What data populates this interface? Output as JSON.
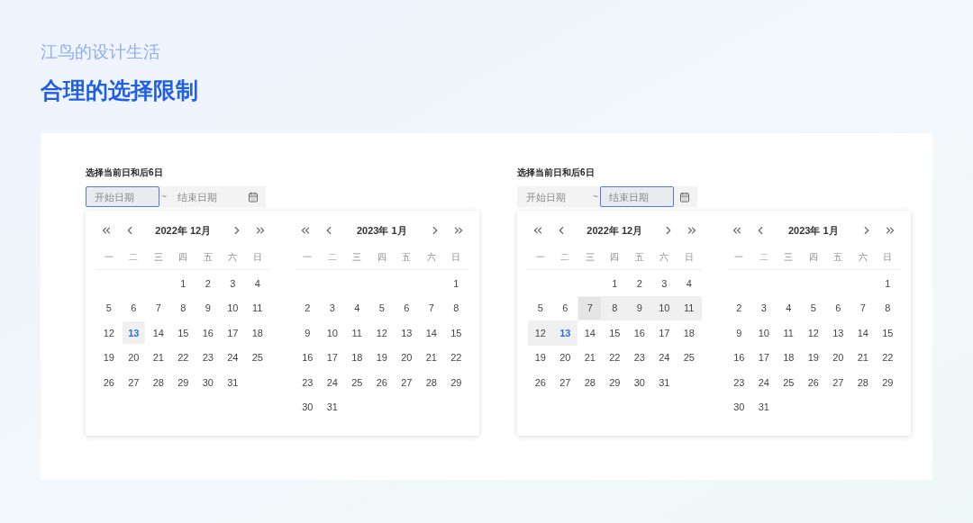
{
  "header": {
    "subtitle": "江鸟的设计生活",
    "title": "合理的选择限制"
  },
  "demos": [
    {
      "label": "选择当前日和后6日",
      "start_field": {
        "placeholder": "开始日期",
        "focused": true
      },
      "separator": "~",
      "end_field": {
        "placeholder": "结束日期",
        "focused": false
      },
      "months": [
        {
          "title": "2022年 12月",
          "weekdays": [
            "一",
            "二",
            "三",
            "四",
            "五",
            "六",
            "日"
          ],
          "days": [
            {
              "kind": "blank"
            },
            {
              "kind": "blank"
            },
            {
              "kind": "blank"
            },
            {
              "kind": "day",
              "text": "1",
              "today": false,
              "in_range": false,
              "hovered": false
            },
            {
              "kind": "day",
              "text": "2",
              "today": false,
              "in_range": false,
              "hovered": false
            },
            {
              "kind": "day",
              "text": "3",
              "today": false,
              "in_range": false,
              "hovered": false
            },
            {
              "kind": "day",
              "text": "4",
              "today": false,
              "in_range": false,
              "hovered": false
            },
            {
              "kind": "day",
              "text": "5",
              "today": false,
              "in_range": false,
              "hovered": false
            },
            {
              "kind": "day",
              "text": "6",
              "today": false,
              "in_range": false,
              "hovered": false
            },
            {
              "kind": "day",
              "text": "7",
              "today": false,
              "in_range": false,
              "hovered": false
            },
            {
              "kind": "day",
              "text": "8",
              "today": false,
              "in_range": false,
              "hovered": false
            },
            {
              "kind": "day",
              "text": "9",
              "today": false,
              "in_range": false,
              "hovered": false
            },
            {
              "kind": "day",
              "text": "10",
              "today": false,
              "in_range": false,
              "hovered": false
            },
            {
              "kind": "day",
              "text": "11",
              "today": false,
              "in_range": false,
              "hovered": false
            },
            {
              "kind": "day",
              "text": "12",
              "today": false,
              "in_range": false,
              "hovered": false
            },
            {
              "kind": "day",
              "text": "13",
              "today": true,
              "in_range": false,
              "hovered": false
            },
            {
              "kind": "day",
              "text": "14",
              "today": false,
              "in_range": false,
              "hovered": false
            },
            {
              "kind": "day",
              "text": "15",
              "today": false,
              "in_range": false,
              "hovered": false
            },
            {
              "kind": "day",
              "text": "16",
              "today": false,
              "in_range": false,
              "hovered": false
            },
            {
              "kind": "day",
              "text": "17",
              "today": false,
              "in_range": false,
              "hovered": false
            },
            {
              "kind": "day",
              "text": "18",
              "today": false,
              "in_range": false,
              "hovered": false
            },
            {
              "kind": "day",
              "text": "19",
              "today": false,
              "in_range": false,
              "hovered": false
            },
            {
              "kind": "day",
              "text": "20",
              "today": false,
              "in_range": false,
              "hovered": false
            },
            {
              "kind": "day",
              "text": "21",
              "today": false,
              "in_range": false,
              "hovered": false
            },
            {
              "kind": "day",
              "text": "22",
              "today": false,
              "in_range": false,
              "hovered": false
            },
            {
              "kind": "day",
              "text": "23",
              "today": false,
              "in_range": false,
              "hovered": false
            },
            {
              "kind": "day",
              "text": "24",
              "today": false,
              "in_range": false,
              "hovered": false
            },
            {
              "kind": "day",
              "text": "25",
              "today": false,
              "in_range": false,
              "hovered": false
            },
            {
              "kind": "day",
              "text": "26",
              "today": false,
              "in_range": false,
              "hovered": false
            },
            {
              "kind": "day",
              "text": "27",
              "today": false,
              "in_range": false,
              "hovered": false
            },
            {
              "kind": "day",
              "text": "28",
              "today": false,
              "in_range": false,
              "hovered": false
            },
            {
              "kind": "day",
              "text": "29",
              "today": false,
              "in_range": false,
              "hovered": false
            },
            {
              "kind": "day",
              "text": "30",
              "today": false,
              "in_range": false,
              "hovered": false
            },
            {
              "kind": "day",
              "text": "31",
              "today": false,
              "in_range": false,
              "hovered": false
            }
          ]
        },
        {
          "title": "2023年 1月",
          "weekdays": [
            "一",
            "二",
            "三",
            "四",
            "五",
            "六",
            "日"
          ],
          "days": [
            {
              "kind": "blank"
            },
            {
              "kind": "blank"
            },
            {
              "kind": "blank"
            },
            {
              "kind": "blank"
            },
            {
              "kind": "blank"
            },
            {
              "kind": "blank"
            },
            {
              "kind": "day",
              "text": "1",
              "today": false,
              "in_range": false,
              "hovered": false
            },
            {
              "kind": "day",
              "text": "2",
              "today": false,
              "in_range": false,
              "hovered": false
            },
            {
              "kind": "day",
              "text": "3",
              "today": false,
              "in_range": false,
              "hovered": false
            },
            {
              "kind": "day",
              "text": "4",
              "today": false,
              "in_range": false,
              "hovered": false
            },
            {
              "kind": "day",
              "text": "5",
              "today": false,
              "in_range": false,
              "hovered": false
            },
            {
              "kind": "day",
              "text": "6",
              "today": false,
              "in_range": false,
              "hovered": false
            },
            {
              "kind": "day",
              "text": "7",
              "today": false,
              "in_range": false,
              "hovered": false
            },
            {
              "kind": "day",
              "text": "8",
              "today": false,
              "in_range": false,
              "hovered": false
            },
            {
              "kind": "day",
              "text": "9",
              "today": false,
              "in_range": false,
              "hovered": false
            },
            {
              "kind": "day",
              "text": "10",
              "today": false,
              "in_range": false,
              "hovered": false
            },
            {
              "kind": "day",
              "text": "11",
              "today": false,
              "in_range": false,
              "hovered": false
            },
            {
              "kind": "day",
              "text": "12",
              "today": false,
              "in_range": false,
              "hovered": false
            },
            {
              "kind": "day",
              "text": "13",
              "today": false,
              "in_range": false,
              "hovered": false
            },
            {
              "kind": "day",
              "text": "14",
              "today": false,
              "in_range": false,
              "hovered": false
            },
            {
              "kind": "day",
              "text": "15",
              "today": false,
              "in_range": false,
              "hovered": false
            },
            {
              "kind": "day",
              "text": "16",
              "today": false,
              "in_range": false,
              "hovered": false
            },
            {
              "kind": "day",
              "text": "17",
              "today": false,
              "in_range": false,
              "hovered": false
            },
            {
              "kind": "day",
              "text": "18",
              "today": false,
              "in_range": false,
              "hovered": false
            },
            {
              "kind": "day",
              "text": "19",
              "today": false,
              "in_range": false,
              "hovered": false
            },
            {
              "kind": "day",
              "text": "20",
              "today": false,
              "in_range": false,
              "hovered": false
            },
            {
              "kind": "day",
              "text": "21",
              "today": false,
              "in_range": false,
              "hovered": false
            },
            {
              "kind": "day",
              "text": "22",
              "today": false,
              "in_range": false,
              "hovered": false
            },
            {
              "kind": "day",
              "text": "23",
              "today": false,
              "in_range": false,
              "hovered": false
            },
            {
              "kind": "day",
              "text": "24",
              "today": false,
              "in_range": false,
              "hovered": false
            },
            {
              "kind": "day",
              "text": "25",
              "today": false,
              "in_range": false,
              "hovered": false
            },
            {
              "kind": "day",
              "text": "26",
              "today": false,
              "in_range": false,
              "hovered": false
            },
            {
              "kind": "day",
              "text": "27",
              "today": false,
              "in_range": false,
              "hovered": false
            },
            {
              "kind": "day",
              "text": "28",
              "today": false,
              "in_range": false,
              "hovered": false
            },
            {
              "kind": "day",
              "text": "29",
              "today": false,
              "in_range": false,
              "hovered": false
            },
            {
              "kind": "day",
              "text": "30",
              "today": false,
              "in_range": false,
              "hovered": false
            },
            {
              "kind": "day",
              "text": "31",
              "today": false,
              "in_range": false,
              "hovered": false
            }
          ]
        }
      ]
    },
    {
      "label": "选择当前日和后6日",
      "start_field": {
        "placeholder": "开始日期",
        "focused": false
      },
      "separator": "~",
      "end_field": {
        "placeholder": "结束日期",
        "focused": true
      },
      "months": [
        {
          "title": "2022年 12月",
          "weekdays": [
            "一",
            "二",
            "三",
            "四",
            "五",
            "六",
            "日"
          ],
          "days": [
            {
              "kind": "blank"
            },
            {
              "kind": "blank"
            },
            {
              "kind": "blank"
            },
            {
              "kind": "day",
              "text": "1",
              "today": false,
              "in_range": false,
              "hovered": false
            },
            {
              "kind": "day",
              "text": "2",
              "today": false,
              "in_range": false,
              "hovered": false
            },
            {
              "kind": "day",
              "text": "3",
              "today": false,
              "in_range": false,
              "hovered": false
            },
            {
              "kind": "day",
              "text": "4",
              "today": false,
              "in_range": false,
              "hovered": false
            },
            {
              "kind": "day",
              "text": "5",
              "today": false,
              "in_range": false,
              "hovered": false
            },
            {
              "kind": "day",
              "text": "6",
              "today": false,
              "in_range": false,
              "hovered": false
            },
            {
              "kind": "day",
              "text": "7",
              "today": false,
              "in_range": true,
              "hovered": true
            },
            {
              "kind": "day",
              "text": "8",
              "today": false,
              "in_range": true,
              "hovered": false
            },
            {
              "kind": "day",
              "text": "9",
              "today": false,
              "in_range": true,
              "hovered": false
            },
            {
              "kind": "day",
              "text": "10",
              "today": false,
              "in_range": true,
              "hovered": false
            },
            {
              "kind": "day",
              "text": "11",
              "today": false,
              "in_range": true,
              "hovered": false
            },
            {
              "kind": "day",
              "text": "12",
              "today": false,
              "in_range": true,
              "hovered": false
            },
            {
              "kind": "day",
              "text": "13",
              "today": true,
              "in_range": true,
              "hovered": false
            },
            {
              "kind": "day",
              "text": "14",
              "today": false,
              "in_range": false,
              "hovered": false
            },
            {
              "kind": "day",
              "text": "15",
              "today": false,
              "in_range": false,
              "hovered": false
            },
            {
              "kind": "day",
              "text": "16",
              "today": false,
              "in_range": false,
              "hovered": false
            },
            {
              "kind": "day",
              "text": "17",
              "today": false,
              "in_range": false,
              "hovered": false
            },
            {
              "kind": "day",
              "text": "18",
              "today": false,
              "in_range": false,
              "hovered": false
            },
            {
              "kind": "day",
              "text": "19",
              "today": false,
              "in_range": false,
              "hovered": false
            },
            {
              "kind": "day",
              "text": "20",
              "today": false,
              "in_range": false,
              "hovered": false
            },
            {
              "kind": "day",
              "text": "21",
              "today": false,
              "in_range": false,
              "hovered": false
            },
            {
              "kind": "day",
              "text": "22",
              "today": false,
              "in_range": false,
              "hovered": false
            },
            {
              "kind": "day",
              "text": "23",
              "today": false,
              "in_range": false,
              "hovered": false
            },
            {
              "kind": "day",
              "text": "24",
              "today": false,
              "in_range": false,
              "hovered": false
            },
            {
              "kind": "day",
              "text": "25",
              "today": false,
              "in_range": false,
              "hovered": false
            },
            {
              "kind": "day",
              "text": "26",
              "today": false,
              "in_range": false,
              "hovered": false
            },
            {
              "kind": "day",
              "text": "27",
              "today": false,
              "in_range": false,
              "hovered": false
            },
            {
              "kind": "day",
              "text": "28",
              "today": false,
              "in_range": false,
              "hovered": false
            },
            {
              "kind": "day",
              "text": "29",
              "today": false,
              "in_range": false,
              "hovered": false
            },
            {
              "kind": "day",
              "text": "30",
              "today": false,
              "in_range": false,
              "hovered": false
            },
            {
              "kind": "day",
              "text": "31",
              "today": false,
              "in_range": false,
              "hovered": false
            }
          ]
        },
        {
          "title": "2023年 1月",
          "weekdays": [
            "一",
            "二",
            "三",
            "四",
            "五",
            "六",
            "日"
          ],
          "days": [
            {
              "kind": "blank"
            },
            {
              "kind": "blank"
            },
            {
              "kind": "blank"
            },
            {
              "kind": "blank"
            },
            {
              "kind": "blank"
            },
            {
              "kind": "blank"
            },
            {
              "kind": "day",
              "text": "1",
              "today": false,
              "in_range": false,
              "hovered": false
            },
            {
              "kind": "day",
              "text": "2",
              "today": false,
              "in_range": false,
              "hovered": false
            },
            {
              "kind": "day",
              "text": "3",
              "today": false,
              "in_range": false,
              "hovered": false
            },
            {
              "kind": "day",
              "text": "4",
              "today": false,
              "in_range": false,
              "hovered": false
            },
            {
              "kind": "day",
              "text": "5",
              "today": false,
              "in_range": false,
              "hovered": false
            },
            {
              "kind": "day",
              "text": "6",
              "today": false,
              "in_range": false,
              "hovered": false
            },
            {
              "kind": "day",
              "text": "7",
              "today": false,
              "in_range": false,
              "hovered": false
            },
            {
              "kind": "day",
              "text": "8",
              "today": false,
              "in_range": false,
              "hovered": false
            },
            {
              "kind": "day",
              "text": "9",
              "today": false,
              "in_range": false,
              "hovered": false
            },
            {
              "kind": "day",
              "text": "10",
              "today": false,
              "in_range": false,
              "hovered": false
            },
            {
              "kind": "day",
              "text": "11",
              "today": false,
              "in_range": false,
              "hovered": false
            },
            {
              "kind": "day",
              "text": "12",
              "today": false,
              "in_range": false,
              "hovered": false
            },
            {
              "kind": "day",
              "text": "13",
              "today": false,
              "in_range": false,
              "hovered": false
            },
            {
              "kind": "day",
              "text": "14",
              "today": false,
              "in_range": false,
              "hovered": false
            },
            {
              "kind": "day",
              "text": "15",
              "today": false,
              "in_range": false,
              "hovered": false
            },
            {
              "kind": "day",
              "text": "16",
              "today": false,
              "in_range": false,
              "hovered": false
            },
            {
              "kind": "day",
              "text": "17",
              "today": false,
              "in_range": false,
              "hovered": false
            },
            {
              "kind": "day",
              "text": "18",
              "today": false,
              "in_range": false,
              "hovered": false
            },
            {
              "kind": "day",
              "text": "19",
              "today": false,
              "in_range": false,
              "hovered": false
            },
            {
              "kind": "day",
              "text": "20",
              "today": false,
              "in_range": false,
              "hovered": false
            },
            {
              "kind": "day",
              "text": "21",
              "today": false,
              "in_range": false,
              "hovered": false
            },
            {
              "kind": "day",
              "text": "22",
              "today": false,
              "in_range": false,
              "hovered": false
            },
            {
              "kind": "day",
              "text": "23",
              "today": false,
              "in_range": false,
              "hovered": false
            },
            {
              "kind": "day",
              "text": "24",
              "today": false,
              "in_range": false,
              "hovered": false
            },
            {
              "kind": "day",
              "text": "25",
              "today": false,
              "in_range": false,
              "hovered": false
            },
            {
              "kind": "day",
              "text": "26",
              "today": false,
              "in_range": false,
              "hovered": false
            },
            {
              "kind": "day",
              "text": "27",
              "today": false,
              "in_range": false,
              "hovered": false
            },
            {
              "kind": "day",
              "text": "28",
              "today": false,
              "in_range": false,
              "hovered": false
            },
            {
              "kind": "day",
              "text": "29",
              "today": false,
              "in_range": false,
              "hovered": false
            },
            {
              "kind": "day",
              "text": "30",
              "today": false,
              "in_range": false,
              "hovered": false
            },
            {
              "kind": "day",
              "text": "31",
              "today": false,
              "in_range": false,
              "hovered": false
            }
          ]
        }
      ]
    }
  ]
}
